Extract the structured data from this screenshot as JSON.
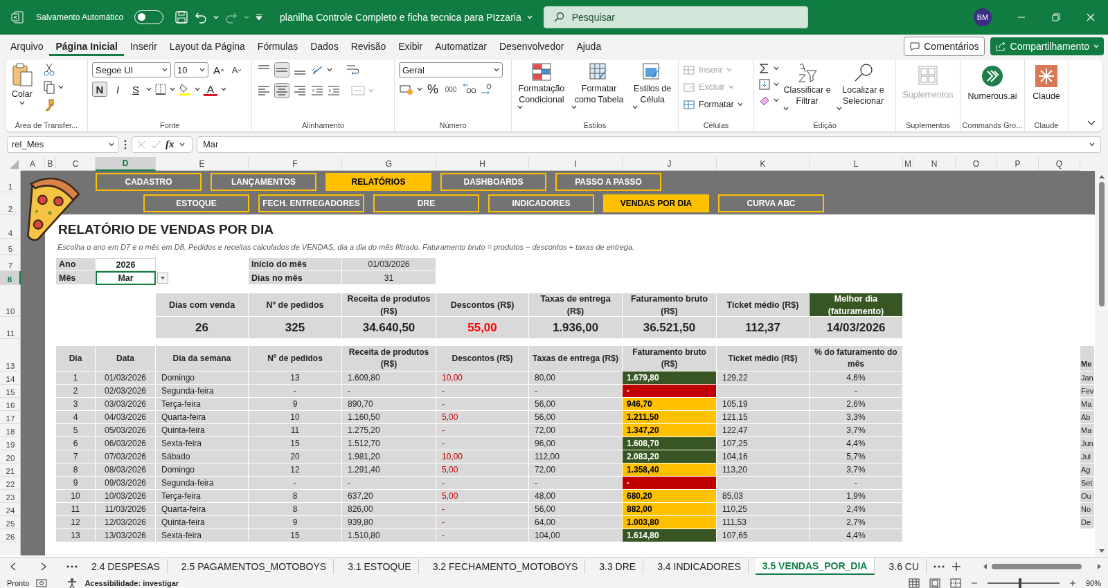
{
  "title_bar": {
    "autosave_label": "Salvamento Automático",
    "autosave_on": false,
    "document_title": "planilha Controle Completo e ficha tecnica para PIzzaria",
    "search_placeholder": "Pesquisar",
    "avatar": "BM"
  },
  "menu": {
    "tabs": [
      {
        "label": "Arquivo",
        "selected": false
      },
      {
        "label": "Página Inicial",
        "selected": true
      },
      {
        "label": "Inserir",
        "selected": false
      },
      {
        "label": "Layout da Página",
        "selected": false
      },
      {
        "label": "Fórmulas",
        "selected": false
      },
      {
        "label": "Dados",
        "selected": false
      },
      {
        "label": "Revisão",
        "selected": false
      },
      {
        "label": "Exibir",
        "selected": false
      },
      {
        "label": "Automatizar",
        "selected": false
      },
      {
        "label": "Desenvolvedor",
        "selected": false
      },
      {
        "label": "Ajuda",
        "selected": false
      }
    ],
    "comments": "Comentários",
    "share": "Compartilhamento"
  },
  "ribbon": {
    "groups": [
      {
        "kind": "clipboard",
        "label": "Área de Transfer...",
        "paste": "Colar"
      },
      {
        "kind": "font",
        "label": "Fonte",
        "font": "Segoe UI",
        "size": "10",
        "grow": "A",
        "shrink": "A",
        "styles": [
          {
            "label": "N",
            "selected": true
          },
          {
            "label": "I",
            "selected": false
          },
          {
            "label": "S",
            "selected": false
          }
        ],
        "color_letter": "A"
      },
      {
        "kind": "alignment",
        "label": "Alinhamento",
        "vertical": [
          {
            "selected": false
          },
          {
            "selected": true
          },
          {
            "selected": false
          }
        ],
        "horizontal": [
          {
            "selected": false
          },
          {
            "selected": true
          },
          {
            "selected": false
          }
        ],
        "merge_disabled": true
      },
      {
        "kind": "number",
        "label": "Número",
        "format": "Geral",
        "percent": "%",
        "thousands": "000"
      },
      {
        "kind": "styles",
        "label": "Estilos",
        "buttons": [
          "Formatação Condicional",
          "Formatar como Tabela",
          "Estilos de Célula"
        ]
      },
      {
        "kind": "cells",
        "label": "Células",
        "items": [
          {
            "label": "Inserir",
            "disabled": true
          },
          {
            "label": "Excluir",
            "disabled": true
          },
          {
            "label": "Formatar",
            "disabled": false
          }
        ]
      },
      {
        "kind": "editing",
        "label": "Edição",
        "buttons": [
          "Classificar e Filtrar",
          "Localizar e Selecionar"
        ]
      },
      {
        "kind": "gridapp",
        "label": "Suplementos",
        "button": "Suplementos",
        "disabled": true
      },
      {
        "kind": "circleapp",
        "label": "Commands Gro...",
        "button": "Numerous.ai",
        "disabled": false
      },
      {
        "kind": "starapp",
        "label": "Claude",
        "button": "Claude",
        "disabled": false
      }
    ]
  },
  "formula_bar": {
    "name_box": "rel_Mes",
    "function_label": "fx",
    "value": "Mar"
  },
  "columns": [
    {
      "label": "A",
      "selected": false
    },
    {
      "label": "B",
      "selected": false
    },
    {
      "label": "C",
      "selected": false
    },
    {
      "label": "D",
      "selected": true
    },
    {
      "label": "E",
      "selected": false
    },
    {
      "label": "F",
      "selected": false
    },
    {
      "label": "G",
      "selected": false
    },
    {
      "label": "H",
      "selected": false
    },
    {
      "label": "I",
      "selected": false
    },
    {
      "label": "J",
      "selected": false
    },
    {
      "label": "K",
      "selected": false
    },
    {
      "label": "L",
      "selected": false
    },
    {
      "label": "M",
      "selected": false
    },
    {
      "label": "N",
      "selected": false
    },
    {
      "label": "O",
      "selected": false
    },
    {
      "label": "P",
      "selected": false
    },
    {
      "label": "Q",
      "selected": false
    }
  ],
  "row_numbers": [
    {
      "label": "1",
      "selected": false
    },
    {
      "label": "2",
      "selected": false
    },
    {
      "label": "4",
      "selected": false
    },
    {
      "label": "5",
      "selected": false
    },
    {
      "label": "7",
      "selected": false
    },
    {
      "label": "8",
      "selected": true
    },
    {
      "label": "10",
      "selected": false
    },
    {
      "label": "11",
      "selected": false
    },
    {
      "label": "13",
      "selected": false
    },
    {
      "label": "14",
      "selected": false
    },
    {
      "label": "15",
      "selected": false
    },
    {
      "label": "16",
      "selected": false
    },
    {
      "label": "17",
      "selected": false
    },
    {
      "label": "18",
      "selected": false
    },
    {
      "label": "19",
      "selected": false
    },
    {
      "label": "20",
      "selected": false
    },
    {
      "label": "21",
      "selected": false
    },
    {
      "label": "22",
      "selected": false
    },
    {
      "label": "23",
      "selected": false
    },
    {
      "label": "24",
      "selected": false
    },
    {
      "label": "25",
      "selected": false
    },
    {
      "label": "26",
      "selected": false
    }
  ],
  "nav": {
    "top": [
      {
        "label": "CADASTRO",
        "selected": false
      },
      {
        "label": "LANÇAMENTOS",
        "selected": false
      },
      {
        "label": "RELATÓRIOS",
        "selected": true
      },
      {
        "label": "DASHBOARDS",
        "selected": false
      },
      {
        "label": "PASSO A PASSO",
        "selected": false
      }
    ],
    "bottom": [
      {
        "label": "ESTOQUE",
        "selected": false
      },
      {
        "label": "FECH. ENTREGADORES",
        "selected": false
      },
      {
        "label": "DRE",
        "selected": false
      },
      {
        "label": "INDICADORES",
        "selected": false
      },
      {
        "label": "VENDAS POR DIA",
        "selected": true
      },
      {
        "label": "CURVA ABC",
        "selected": false
      }
    ]
  },
  "report": {
    "title": "RELATÓRIO DE VENDAS POR DIA",
    "subtitle": "Escolha o ano em D7 e o mês em D8. Pedidos e receitas calculados de VENDAS, dia a dia do mês filtrado. Faturamento bruto = produtos − descontos + taxas de entrega."
  },
  "filters": [
    {
      "label": "Ano",
      "value": "2026",
      "selected": false
    },
    {
      "label": "Mês",
      "value": "Mar",
      "dropdown": true,
      "selected": true
    }
  ],
  "month_info": [
    {
      "label": "Início do mês",
      "value": "01/03/2026"
    },
    {
      "label": "Dias no mês",
      "value": "31"
    }
  ],
  "summary": [
    {
      "label": "Dias com venda",
      "value": "26",
      "kind": "plain"
    },
    {
      "label": "Nº de pedidos",
      "value": "325",
      "kind": "plain"
    },
    {
      "label": "Receita de produtos (R$)",
      "value": "34.640,50",
      "kind": "plain"
    },
    {
      "label": "Descontos (R$)",
      "value": "55,00",
      "kind": "negative"
    },
    {
      "label": "Taxas de entrega (R$)",
      "value": "1.936,00",
      "kind": "plain"
    },
    {
      "label": "Faturamento bruto (R$)",
      "value": "36.521,50",
      "kind": "plain"
    },
    {
      "label": "Ticket médio (R$)",
      "value": "112,37",
      "kind": "plain"
    },
    {
      "label": "Melhor dia (faturamento)",
      "value": "14/03/2026",
      "kind": "best"
    }
  ],
  "table": {
    "columns": [
      "Dia",
      "Data",
      "Dia da semana",
      "Nº de pedidos",
      "Receita de produtos (R$)",
      "Descontos (R$)",
      "Taxas de entrega (R$)",
      "Faturamento bruto (R$)",
      "Ticket médio (R$)",
      "% do faturamento do mês"
    ],
    "rows": [
      {
        "day": "1",
        "date": "01/03/2026",
        "weekday": "Domingo",
        "orders": "13",
        "revenue": "1.609,80",
        "discount": "10,00",
        "delivery": "80,00",
        "gross": "1.679,80",
        "color": "#375623",
        "ticket": "129,22",
        "share": "4,6%"
      },
      {
        "day": "2",
        "date": "02/03/2026",
        "weekday": "Segunda-feira",
        "orders": "-",
        "revenue": "-",
        "discount": "-",
        "delivery": "-",
        "gross": "-",
        "color": "#c00000",
        "share": "-"
      },
      {
        "day": "3",
        "date": "03/03/2026",
        "weekday": "Terça-feira",
        "orders": "9",
        "revenue": "890,70",
        "discount": "-",
        "delivery": "56,00",
        "gross": "946,70",
        "color": "#ffc000",
        "ticket": "105,19",
        "share": "2,6%"
      },
      {
        "day": "4",
        "date": "04/03/2026",
        "weekday": "Quarta-feira",
        "orders": "10",
        "revenue": "1.160,50",
        "discount": "5,00",
        "delivery": "56,00",
        "gross": "1.211,50",
        "color": "#ffc000",
        "ticket": "121,15",
        "share": "3,3%"
      },
      {
        "day": "5",
        "date": "05/03/2026",
        "weekday": "Quinta-feira",
        "orders": "11",
        "revenue": "1.275,20",
        "discount": "-",
        "delivery": "72,00",
        "gross": "1.347,20",
        "color": "#ffc000",
        "ticket": "122,47",
        "share": "3,7%"
      },
      {
        "day": "6",
        "date": "06/03/2026",
        "weekday": "Sexta-feira",
        "orders": "15",
        "revenue": "1.512,70",
        "discount": "-",
        "delivery": "96,00",
        "gross": "1.608,70",
        "color": "#375623",
        "ticket": "107,25",
        "share": "4,4%"
      },
      {
        "day": "7",
        "date": "07/03/2026",
        "weekday": "Sábado",
        "orders": "20",
        "revenue": "1.981,20",
        "discount": "10,00",
        "delivery": "112,00",
        "gross": "2.083,20",
        "color": "#375623",
        "ticket": "104,16",
        "share": "5,7%"
      },
      {
        "day": "8",
        "date": "08/03/2026",
        "weekday": "Domingo",
        "orders": "12",
        "revenue": "1.291,40",
        "discount": "5,00",
        "delivery": "72,00",
        "gross": "1.358,40",
        "color": "#ffc000",
        "ticket": "113,20",
        "share": "3,7%"
      },
      {
        "day": "9",
        "date": "09/03/2026",
        "weekday": "Segunda-feira",
        "orders": "-",
        "revenue": "-",
        "discount": "-",
        "delivery": "-",
        "gross": "-",
        "color": "#c00000",
        "share": "-"
      },
      {
        "day": "10",
        "date": "10/03/2026",
        "weekday": "Terça-feira",
        "orders": "8",
        "revenue": "637,20",
        "discount": "5,00",
        "delivery": "48,00",
        "gross": "680,20",
        "color": "#ffc000",
        "ticket": "85,03",
        "share": "1,9%"
      },
      {
        "day": "11",
        "date": "11/03/2026",
        "weekday": "Quarta-feira",
        "orders": "8",
        "revenue": "826,00",
        "discount": "-",
        "delivery": "56,00",
        "gross": "882,00",
        "color": "#ffc000",
        "ticket": "110,25",
        "share": "2,4%"
      },
      {
        "day": "12",
        "date": "12/03/2026",
        "weekday": "Quinta-feira",
        "orders": "9",
        "revenue": "939,80",
        "discount": "-",
        "delivery": "64,00",
        "gross": "1.003,80",
        "color": "#ffc000",
        "ticket": "111,53",
        "share": "2,7%"
      },
      {
        "day": "13",
        "date": "13/03/2026",
        "weekday": "Sexta-feira",
        "orders": "15",
        "revenue": "1.510,80",
        "discount": "-",
        "delivery": "104,00",
        "gross": "1.614,80",
        "color": "#375623",
        "ticket": "107,65",
        "share": "4,4%"
      }
    ]
  },
  "month_list": {
    "header": "Me",
    "items": [
      "Jan",
      "Fev",
      "Ma",
      "Ab",
      "Ma",
      "Jun",
      "Jul",
      "Ag",
      "Set",
      "Ou",
      "No",
      "De"
    ]
  },
  "sheet_tabs": [
    {
      "label": "2.4 DESPESAS",
      "selected": false
    },
    {
      "label": "2.5 PAGAMENTOS_MOTOBOYS",
      "selected": false
    },
    {
      "label": "3.1 ESTOQUE",
      "selected": false
    },
    {
      "label": "3.2 FECHAMENTO_MOTOBOYS",
      "selected": false
    },
    {
      "label": "3.3 DRE",
      "selected": false
    },
    {
      "label": "3.4 INDICADORES",
      "selected": false
    },
    {
      "label": "3.5 VENDAS_POR_DIA",
      "selected": true
    },
    {
      "label": "3.6 CU",
      "selected": false
    }
  ],
  "status_bar": {
    "ready": "Pronto",
    "accessibility": "Acessibilidade: investigar",
    "zoom": "90%",
    "zoom_slider": {
      "level": 0.45
    }
  }
}
